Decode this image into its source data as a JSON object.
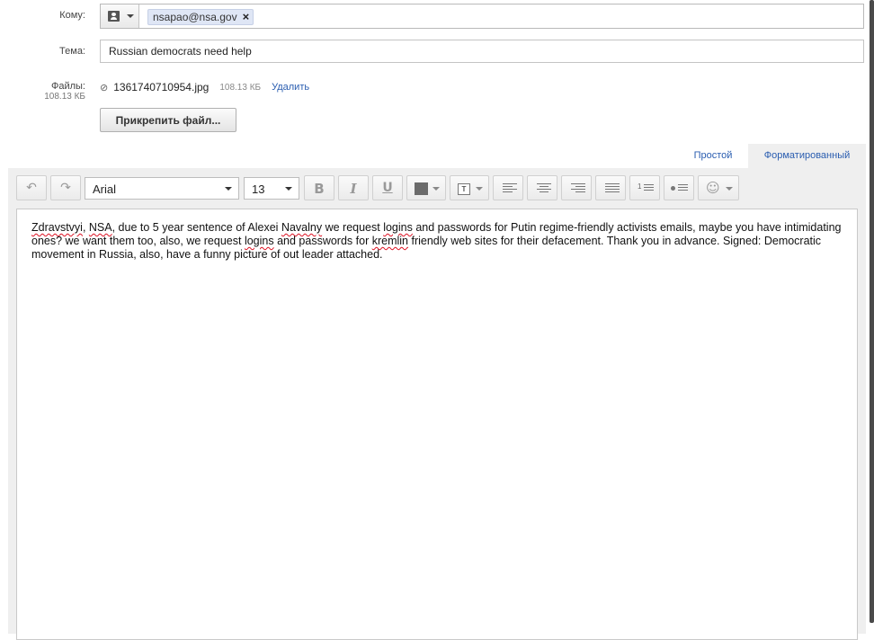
{
  "compose": {
    "to_label": "Кому:",
    "recipient_chip": "nsapao@nsa.gov",
    "remove_chip": "×",
    "subject_label": "Тема:",
    "subject_value": "Russian democrats need help",
    "files_label": "Файлы:",
    "files_total": "108.13 КБ",
    "attachment": {
      "name": "1361740710954.jpg",
      "size": "108.13 КБ",
      "delete_label": "Удалить"
    },
    "attach_button": "Прикрепить файл..."
  },
  "editor_tabs": {
    "plain": "Простой",
    "formatted": "Форматированный"
  },
  "toolbar": {
    "font": "Arial",
    "size": "13",
    "text_color": "#6b6b6b"
  },
  "body": {
    "w_zdravstvyi": "Zdravstvyi",
    "w_nsa": "NSA",
    "p1": ", due to 5 year sentence of Alexei ",
    "w_navalny": "Navalny",
    "p2": " we request ",
    "w_logins1": "logins",
    "p3": " and passwords for Putin regime-friendly activists emails, maybe you have intimidating ones? we want them too, also, we request ",
    "w_logins2": "logins",
    "p4": " and passwords for ",
    "w_kremlin": "kremlin",
    "p5": " friendly web sites for their defacement. Thank you in advance. Signed: Democratic movement in Russia, also, have a funny picture of out leader attached."
  }
}
